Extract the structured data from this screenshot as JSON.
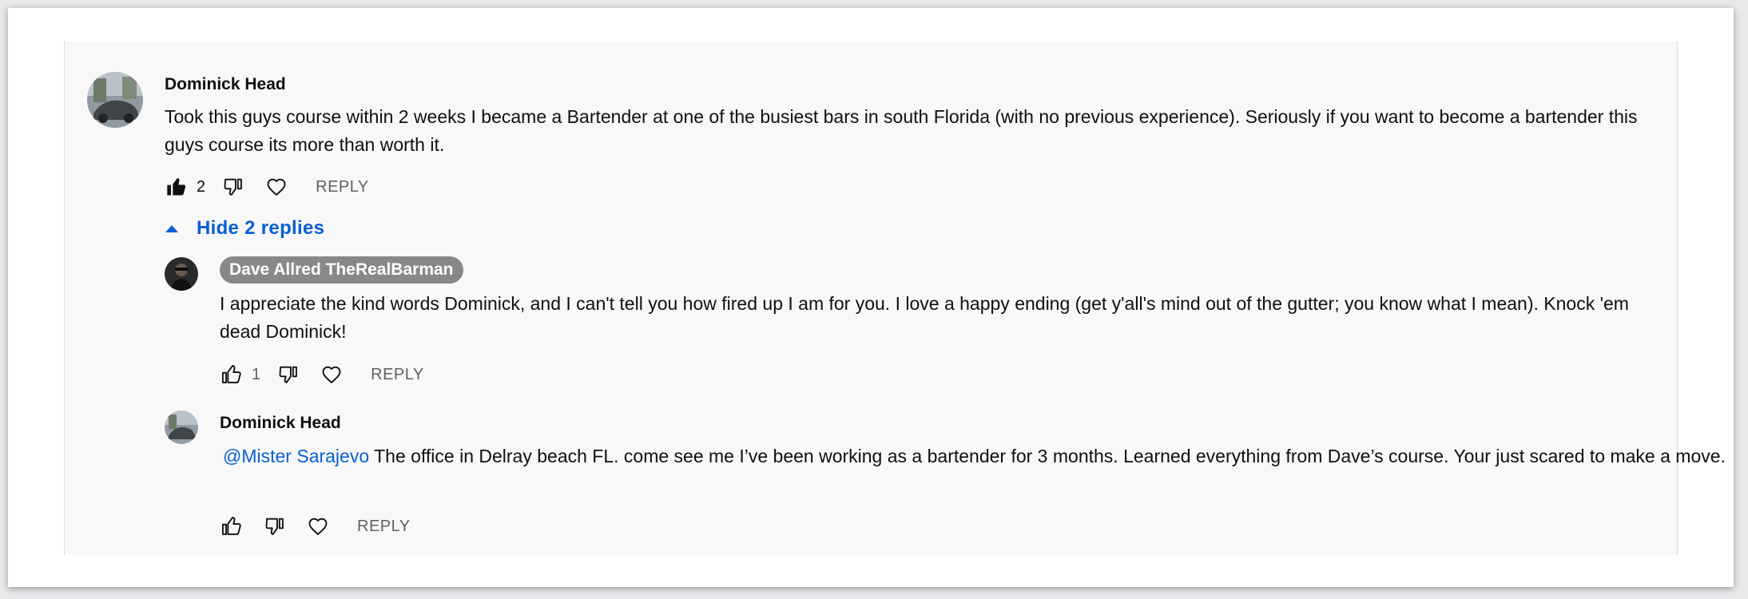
{
  "comment": {
    "author": "Dominick Head",
    "text": "Took this guys course within 2 weeks I became a Bartender at one of the busiest bars in south Florida (with no previous experience). Seriously if you want to become a bartender this guys course its more than worth it.",
    "likes": "2",
    "reply_label": "REPLY"
  },
  "replies_toggle": {
    "label": "Hide 2 replies"
  },
  "replies": [
    {
      "author": "Dave Allred TheRealBarman",
      "text": "I appreciate the kind words Dominick, and I can't tell you how fired up I am for you. I love a happy ending (get y'all's mind out of the gutter; you know what I mean). Knock 'em dead Dominick!",
      "likes": "1",
      "reply_label": "REPLY"
    },
    {
      "author": "Dominick Head",
      "mention": "@Mister Sarajevo",
      "text": "The office in Delray beach FL. come see me I’ve been working as a bartender for 3 months. Learned everything from Dave’s course. Your just scared to make a move.",
      "reply_label": "REPLY"
    }
  ],
  "icons": {
    "like": "thumbs-up-icon",
    "dislike": "thumbs-down-icon",
    "heart": "heart-icon",
    "collapse": "caret-up-icon"
  },
  "colors": {
    "link": "#065fd4",
    "owner_badge": "#888888",
    "muted": "#606060",
    "panel_bg": "#f8f8f8"
  }
}
